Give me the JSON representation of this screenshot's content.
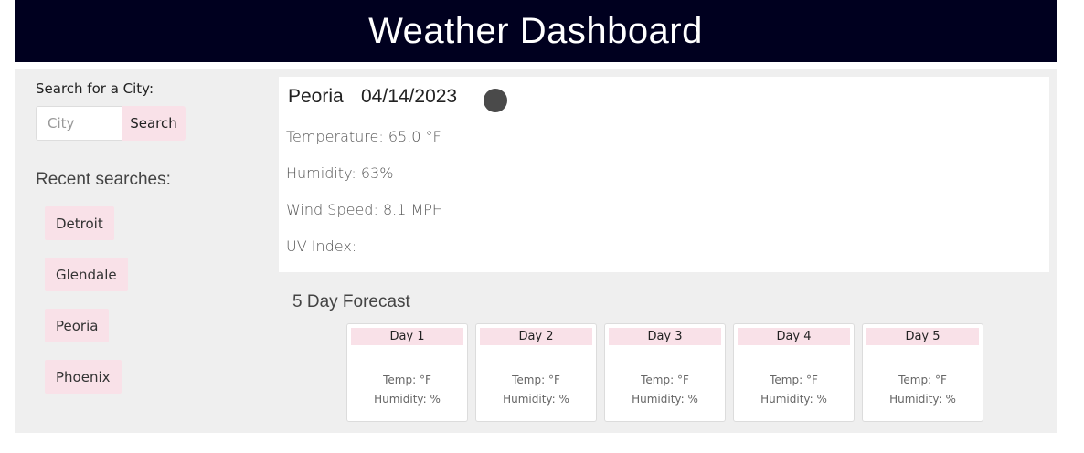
{
  "header": {
    "title": "Weather Dashboard"
  },
  "sidebar": {
    "search_label": "Search for a City:",
    "city_input": {
      "placeholder": "City",
      "value": ""
    },
    "search_button": "Search",
    "recent_title": "Recent searches:",
    "recent": [
      "Detroit",
      "Glendale",
      "Peoria",
      "Phoenix"
    ]
  },
  "current": {
    "city": "Peoria",
    "date": "04/14/2023",
    "icon": "weather-icon",
    "temperature": {
      "label": "Temperature:",
      "value": "65.0 °F"
    },
    "humidity": {
      "label": "Humidity:",
      "value": "63%"
    },
    "wind": {
      "label": "Wind Speed:",
      "value": "8.1 MPH"
    },
    "uv": {
      "label": "UV Index:",
      "value": ""
    }
  },
  "forecast": {
    "title": "5 Day Forecast",
    "days": [
      {
        "label": "Day 1",
        "temp": "Temp: °F",
        "humidity": "Humidity: %"
      },
      {
        "label": "Day 2",
        "temp": "Temp: °F",
        "humidity": "Humidity: %"
      },
      {
        "label": "Day 3",
        "temp": "Temp: °F",
        "humidity": "Humidity: %"
      },
      {
        "label": "Day 4",
        "temp": "Temp: °F",
        "humidity": "Humidity: %"
      },
      {
        "label": "Day 5",
        "temp": "Temp: °F",
        "humidity": "Humidity: %"
      }
    ]
  },
  "colors": {
    "header_bg": "#00001f",
    "accent_pink": "#f9e1e8",
    "panel_bg": "#efefef"
  }
}
